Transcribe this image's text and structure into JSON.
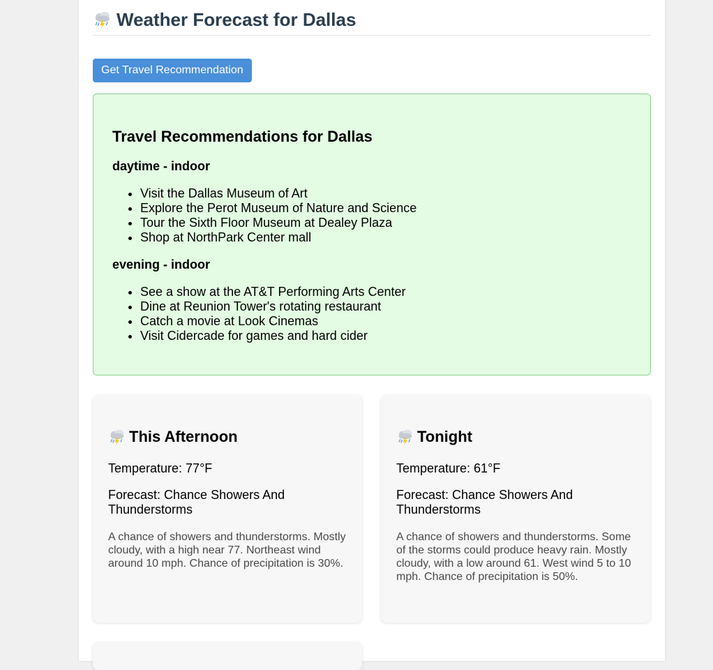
{
  "header": {
    "title": "Weather Forecast for Dallas",
    "icon": "thunderstorm-icon"
  },
  "actions": {
    "recommend_button": "Get Travel Recommendation"
  },
  "recommendations": {
    "title": "Travel Recommendations for Dallas",
    "sections": [
      {
        "heading": "daytime - indoor",
        "items": [
          "Visit the Dallas Museum of Art",
          "Explore the Perot Museum of Nature and Science",
          "Tour the Sixth Floor Museum at Dealey Plaza",
          "Shop at NorthPark Center mall"
        ]
      },
      {
        "heading": "evening - indoor",
        "items": [
          "See a show at the AT&T Performing Arts Center",
          "Dine at Reunion Tower's rotating restaurant",
          "Catch a movie at Look Cinemas",
          "Visit Cidercade for games and hard cider"
        ]
      }
    ]
  },
  "forecasts": [
    {
      "period": "This Afternoon",
      "icon": "thunderstorm-icon",
      "temperature": "Temperature: 77°F",
      "forecast": "Forecast: Chance Showers And Thunderstorms",
      "detail": "A chance of showers and thunderstorms. Mostly cloudy, with a high near 77. Northeast wind around 10 mph. Chance of precipitation is 30%."
    },
    {
      "period": "Tonight",
      "icon": "thunderstorm-icon",
      "temperature": "Temperature: 61°F",
      "forecast": "Forecast: Chance Showers And Thunderstorms",
      "detail": "A chance of showers and thunderstorms. Some of the storms could produce heavy rain. Mostly cloudy, with a low around 61. West wind 5 to 10 mph. Chance of precipitation is 50%."
    }
  ],
  "colors": {
    "title": "#2c3e50",
    "button": "#4a8fd9",
    "reco_bg": "#e3fce3",
    "reco_border": "#8fd18f",
    "card_bg": "#f7f7f7"
  }
}
